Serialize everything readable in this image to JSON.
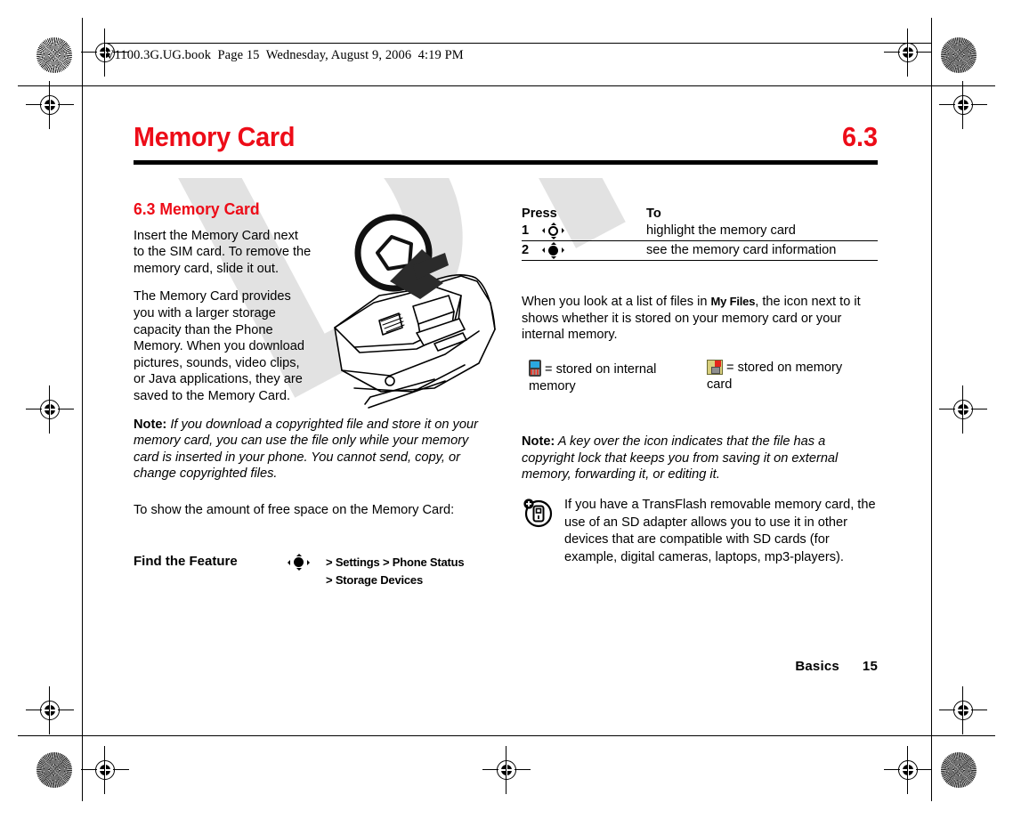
{
  "print_header": {
    "text": "V1100.3G.UG.book  Page 15  Wednesday, August 9, 2006  4:19 PM"
  },
  "chapter": {
    "title": "Memory Card",
    "number": "6.3"
  },
  "watermark": {
    "text": "DRAFT",
    "color": "#e2e2e2"
  },
  "accent_color": "#ed0c18",
  "left_column": {
    "section_heading": "6.3 Memory Card",
    "paragraph_1": "Insert the Memory Card next to the SIM card. To remove the memory card, slide it out.",
    "paragraph_2": "The Memory Card provides you with a larger storage capacity than the Phone Memory. When you download pictures, sounds, video clips, or Java applications, they are saved to the Memory Card.",
    "note_label": "Note:",
    "note_text": " If you download a copyrighted file and store it on your memory card, you can use the file only while your memory card is inserted in your phone. You cannot send, copy, or change copyrighted files.",
    "paragraph_3": "To show the amount of free space on the Memory Card:",
    "find_the_feature": {
      "label": "Find the Feature",
      "key_icon": "navigation-key-filled-icon",
      "path_line_1_prefix": ">",
      "path_line_1_item_1": "Settings",
      "path_line_1_sep": ">",
      "path_line_1_item_2": "Phone Status",
      "path_line_2_prefix": ">",
      "path_line_2_item_1": "Storage Devices"
    },
    "illustration": {
      "name": "phone-memory-card-slot-illustration",
      "caption": ""
    }
  },
  "right_column": {
    "press_table": {
      "headers": [
        "Press",
        "To"
      ],
      "rows": [
        {
          "num": "1",
          "key_icon": "navigation-key-hollow-icon",
          "to": "highlight the memory card"
        },
        {
          "num": "2",
          "key_icon": "navigation-key-filled-icon",
          "to": "see the memory card information"
        }
      ]
    },
    "paragraph_1_part_1": "When you look at a list of files in ",
    "paragraph_1_keyword": "My Files",
    "paragraph_1_part_2": ", the icon next to it shows whether it is stored on your memory card or your internal memory.",
    "legend": [
      {
        "icon": "internal-memory-phone-icon",
        "text": "= stored on internal",
        "text_line2": "memory"
      },
      {
        "icon": "memory-card-icon",
        "text": "= stored on memory",
        "text_line2": "card"
      }
    ],
    "note_label": "Note:",
    "note_text": " A key over the icon indicates that the file has a copyright lock that keeps you from saving it on external memory, forwarding it, or editing it.",
    "tip": {
      "icon": "tip-phone-plus-icon",
      "text": "If you have a TransFlash removable memory card, the use of an SD adapter allows you to use it in other devices that are compatible with SD cards (for example, digital cameras, laptops, mp3-players)."
    }
  },
  "footer": {
    "section": "Basics",
    "page": "15"
  }
}
